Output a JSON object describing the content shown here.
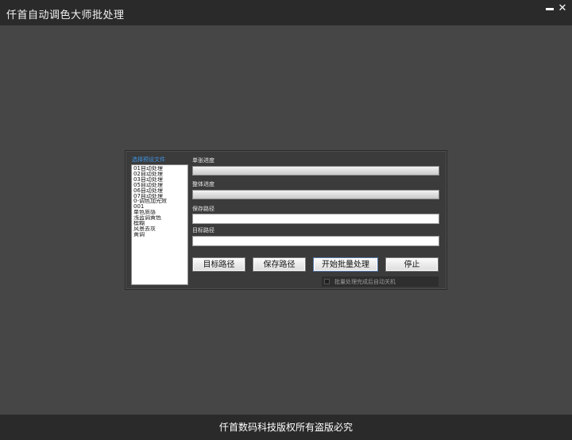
{
  "window": {
    "title": "仟首自动调色大师批处理",
    "minimize_label": "",
    "close_label": "✕"
  },
  "presets": {
    "title": "选择预设文件",
    "items": [
      "01自动处理",
      "02自动处理",
      "03自动处理",
      "05自动处理",
      "06自动处理",
      "07自动处理",
      "0-调色加光效",
      "001",
      "单色质感",
      "浅蓝调黄色",
      "模糊",
      "风景去灰",
      "黄调"
    ]
  },
  "progress": {
    "single_label": "单张进度",
    "single_value": 0,
    "overall_label": "整体进度",
    "overall_value": 0
  },
  "paths": {
    "save_label": "保存路径",
    "save_value": "",
    "target_label": "目标路径",
    "target_value": ""
  },
  "buttons": {
    "target_path": "目标路径",
    "save_path": "保存路径",
    "start_batch": "开始批量处理",
    "stop": "停止"
  },
  "options": {
    "shutdown_label": "批量处理完成后自动关机",
    "shutdown_checked": false
  },
  "footer": {
    "copyright": "仟首数码科技版权所有盗版必究"
  },
  "colors": {
    "background": "#464646",
    "bars": "#2a2a2a",
    "list_title": "#3f95e6"
  }
}
